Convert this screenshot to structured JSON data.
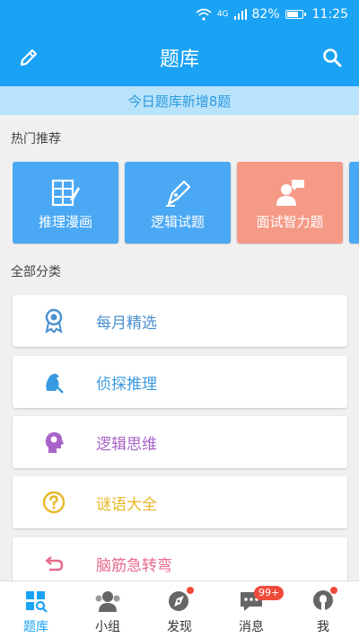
{
  "status_bar": {
    "network": "4G",
    "battery": "82%",
    "battery_level": 0.82,
    "time": "11:25"
  },
  "app_bar": {
    "title": "题库"
  },
  "banner": {
    "text": "今日题库新增8题"
  },
  "hot_section": {
    "label": "热门推荐",
    "cards": [
      {
        "label": "推理漫画",
        "icon": "comic-book-icon",
        "color": "#4aa8f4"
      },
      {
        "label": "逻辑试题",
        "icon": "pen-nib-icon",
        "color": "#4aa8f4"
      },
      {
        "label": "面试智力题",
        "icon": "interview-person-icon",
        "color": "#f59a86"
      }
    ]
  },
  "all_section": {
    "label": "全部分类",
    "items": [
      {
        "label": "每月精选",
        "icon": "award-ribbon-icon",
        "color": "#4a90d0"
      },
      {
        "label": "侦探推理",
        "icon": "detective-icon",
        "color": "#3a9ae0"
      },
      {
        "label": "逻辑思维",
        "icon": "brain-head-icon",
        "color": "#a864c8"
      },
      {
        "label": "谜语大全",
        "icon": "question-bubble-icon",
        "color": "#e8b828"
      },
      {
        "label": "脑筋急转弯",
        "icon": "turn-back-icon",
        "color": "#e86a8c"
      }
    ]
  },
  "tab_bar": {
    "active_color": "#1aa3f4",
    "tabs": [
      {
        "label": "题库",
        "icon": "question-bank-icon"
      },
      {
        "label": "小组",
        "icon": "group-icon"
      },
      {
        "label": "发现",
        "icon": "discover-compass-icon"
      },
      {
        "label": "消息",
        "icon": "message-icon",
        "badge": "99+"
      },
      {
        "label": "我",
        "icon": "profile-icon"
      }
    ]
  }
}
